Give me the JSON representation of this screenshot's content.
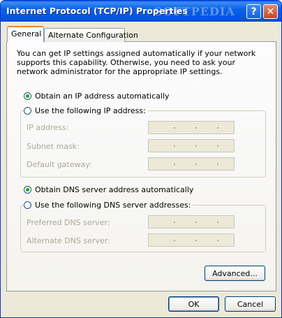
{
  "window": {
    "title": "Internet Protocol (TCP/IP) Properties",
    "watermark": "SOFTPEDIA",
    "help_label": "?",
    "close_label": "✕"
  },
  "tabs": [
    {
      "label": "General",
      "active": true
    },
    {
      "label": "Alternate Configuration",
      "active": false
    }
  ],
  "intro_text": "You can get IP settings assigned automatically if your network supports this capability. Otherwise, you need to ask your network administrator for the appropriate IP settings.",
  "ip_section": {
    "auto_label": "Obtain an IP address automatically",
    "auto_selected": true,
    "manual_label": "Use the following IP address:",
    "fields": [
      {
        "label": "IP address:",
        "value": ""
      },
      {
        "label": "Subnet mask:",
        "value": ""
      },
      {
        "label": "Default gateway:",
        "value": ""
      }
    ]
  },
  "dns_section": {
    "auto_label": "Obtain DNS server address automatically",
    "auto_selected": true,
    "manual_label": "Use the following DNS server addresses:",
    "fields": [
      {
        "label": "Preferred DNS server:",
        "value": ""
      },
      {
        "label": "Alternate DNS server:",
        "value": ""
      }
    ]
  },
  "buttons": {
    "advanced": "Advanced...",
    "ok": "OK",
    "cancel": "Cancel"
  },
  "colors": {
    "titlebar": "#0054e3",
    "dialog_bg": "#ece9d8",
    "radio_dot": "#21a121",
    "disabled_text": "#aca899"
  }
}
